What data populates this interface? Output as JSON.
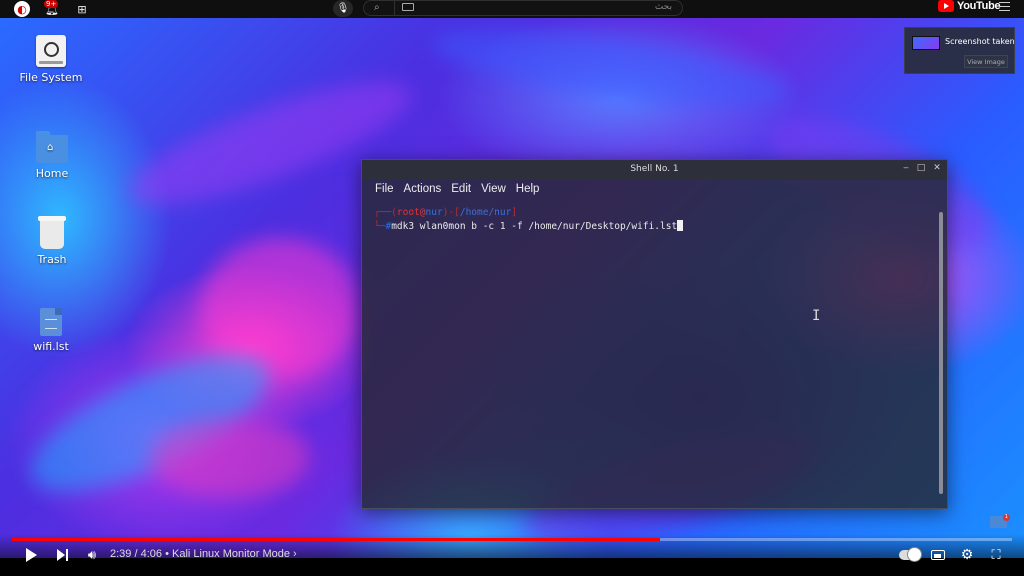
{
  "youtube": {
    "notif_count": "9+",
    "search_placeholder": "بحث",
    "logo_text": "YouTube",
    "player": {
      "time_current": "2:39",
      "time_total": "4:06",
      "time_separator": " / ",
      "bullet": " • ",
      "chapter": "Kali Linux Monitor Mode ›",
      "progress_fraction": 0.648
    }
  },
  "desktop": {
    "icons": [
      {
        "label": "File System",
        "icon": "drive-icon"
      },
      {
        "label": "Home",
        "icon": "home-folder-icon"
      },
      {
        "label": "Trash",
        "icon": "trash-icon"
      },
      {
        "label": "wifi.lst",
        "icon": "text-file-icon"
      }
    ]
  },
  "toast": {
    "title": "Screenshot taken",
    "button": "View Image"
  },
  "terminal": {
    "title": "Shell No. 1",
    "menu": [
      "File",
      "Actions",
      "Edit",
      "View",
      "Help"
    ],
    "prompt": {
      "user": "root",
      "at": "@",
      "host": "nur",
      "path": "/home/nur",
      "hash": "#"
    },
    "command": "mdk3 wlan0mon b -c 1 -f /home/nur/Desktop/wifi.lst"
  },
  "colors": {
    "progress": "#ff0000",
    "prompt_red": "#e03434",
    "prompt_blue": "#2f6fe0"
  }
}
